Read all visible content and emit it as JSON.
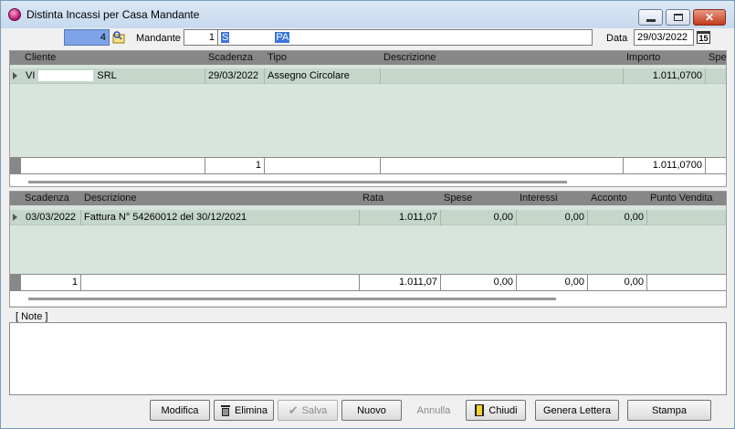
{
  "window": {
    "title": "Distinta Incassi per Casa Mandante",
    "minimize": "_",
    "maximize": "□",
    "close": "✕"
  },
  "filter": {
    "number": "4",
    "mandante_label": "Mandante",
    "mandante_code": "1",
    "mandante_name_start": "S",
    "mandante_name_end": "PA",
    "data_label": "Data",
    "data_value": "29/03/2022",
    "calendar_icon_text": "15"
  },
  "grid1": {
    "headers": [
      "Cliente",
      "Scadenza",
      "Tipo",
      "Descrizione",
      "Importo",
      "Spe"
    ],
    "row": {
      "cliente_start": "VI",
      "cliente_end": "SRL",
      "scadenza": "29/03/2022",
      "tipo": "Assegno Circolare",
      "descrizione": "",
      "importo": "1.011,0700"
    },
    "footer": {
      "count": "1",
      "importo": "1.011,0700"
    }
  },
  "grid2": {
    "headers": [
      "Scadenza",
      "Descrizione",
      "Rata",
      "Spese",
      "Interessi",
      "Acconto",
      "Punto Vendita"
    ],
    "row": {
      "scadenza": "03/03/2022",
      "descrizione": "Fattura N° 54260012 del 30/12/2021",
      "rata": "1.011,07",
      "spese": "0,00",
      "interessi": "0,00",
      "acconto": "0,00",
      "punto_vendita": ""
    },
    "footer": {
      "count": "1",
      "rata": "1.011,07",
      "spese": "0,00",
      "interessi": "0,00",
      "acconto": "0,00"
    }
  },
  "notes": {
    "label": "[ Note ]",
    "value": ""
  },
  "buttons": {
    "modifica": "Modifica",
    "elimina": "Elimina",
    "salva": "Salva",
    "nuovo": "Nuovo",
    "annulla": "Annulla",
    "chiudi": "Chiudi",
    "genera_lettera": "Genera Lettera",
    "stampa": "Stampa"
  },
  "colors": {
    "grid_bg": "#d7e5dc",
    "header_bg": "#878787",
    "selection": "#3b74d8",
    "number_field": "#7fa3e8"
  }
}
